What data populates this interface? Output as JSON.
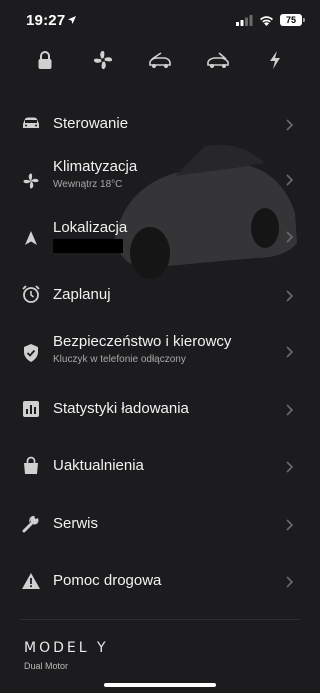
{
  "status": {
    "time": "19:27",
    "battery": "75"
  },
  "quick_controls": [
    {
      "name": "lock-icon"
    },
    {
      "name": "fan-icon"
    },
    {
      "name": "frunk-icon"
    },
    {
      "name": "trunk-icon"
    },
    {
      "name": "charge-icon"
    }
  ],
  "menu": [
    {
      "label": "Sterowanie",
      "icon": "car-icon"
    },
    {
      "label": "Klimatyzacja",
      "sub": "Wewnątrz 18°C",
      "icon": "fan-icon"
    },
    {
      "label": "Lokalizacja",
      "icon": "navigation-arrow-icon"
    },
    {
      "label": "Zaplanuj",
      "icon": "alarm-clock-icon"
    },
    {
      "label": "Bezpieczeństwo i kierowcy",
      "sub": "Kluczyk w telefonie odłączony",
      "icon": "shield-check-icon"
    },
    {
      "label": "Statystyki ładowania",
      "icon": "bar-chart-icon"
    },
    {
      "label": "Uaktualnienia",
      "icon": "shopping-bag-icon"
    },
    {
      "label": "Serwis",
      "icon": "wrench-icon"
    },
    {
      "label": "Pomoc drogowa",
      "icon": "warning-triangle-icon"
    }
  ],
  "vehicle": {
    "model": "MODEL Y",
    "variant": "Dual Motor"
  },
  "colors": {
    "background": "#1c1c1e",
    "text": "#f2f2f2",
    "subtext": "#a8a8a8"
  }
}
